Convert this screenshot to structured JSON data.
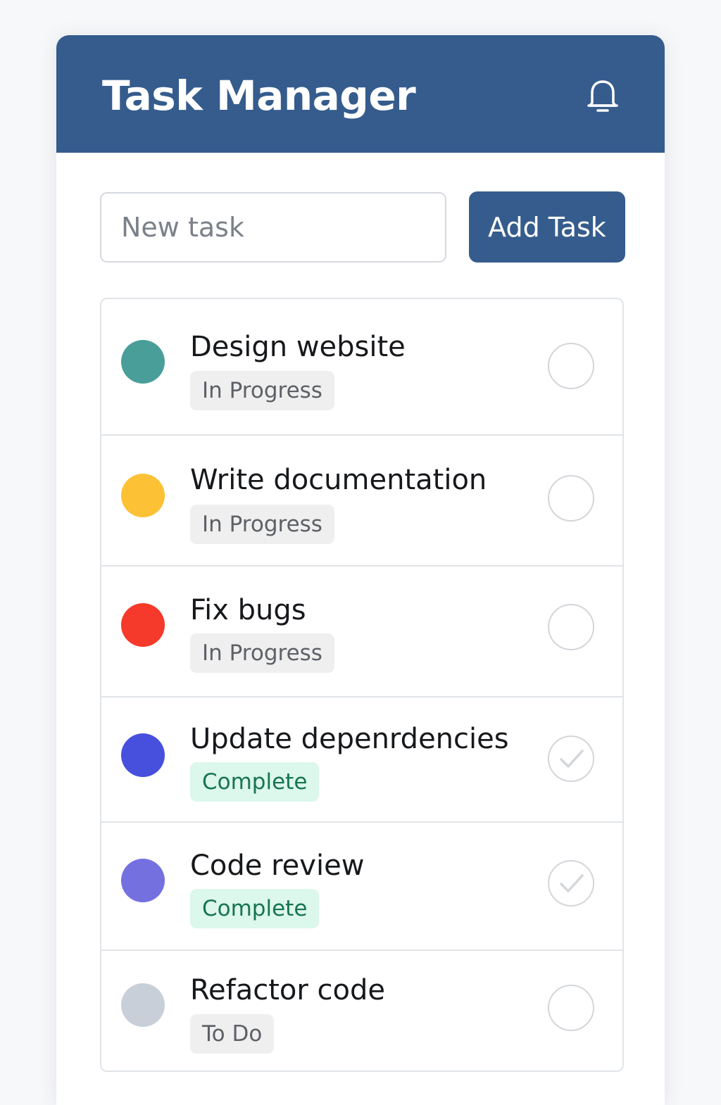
{
  "header": {
    "title": "Task Manager",
    "notifications_icon": "bell-icon"
  },
  "new_task": {
    "placeholder": "New task",
    "value": "",
    "add_label": "Add Task"
  },
  "colors": {
    "brand": "#355c8d",
    "complete_badge_bg": "#dcf7ec",
    "complete_badge_text": "#177551",
    "neutral_badge_bg": "#efefef"
  },
  "tasks": [
    {
      "title": "Design website",
      "status": "In Progress",
      "dot_color": "#4a9e9a",
      "checked": false
    },
    {
      "title": "Write documentation",
      "status": "In Progress",
      "dot_color": "#fdc135",
      "checked": false
    },
    {
      "title": "Fix bugs",
      "status": "In Progress",
      "dot_color": "#f5392a",
      "checked": false
    },
    {
      "title": "Update depenrdencies",
      "status": "Complete",
      "dot_color": "#4650dc",
      "checked": true
    },
    {
      "title": "Code review",
      "status": "Complete",
      "dot_color": "#7570e0",
      "checked": true
    },
    {
      "title": "Refactor code",
      "status": "To Do",
      "dot_color": "#c9cfd9",
      "checked": false
    }
  ]
}
